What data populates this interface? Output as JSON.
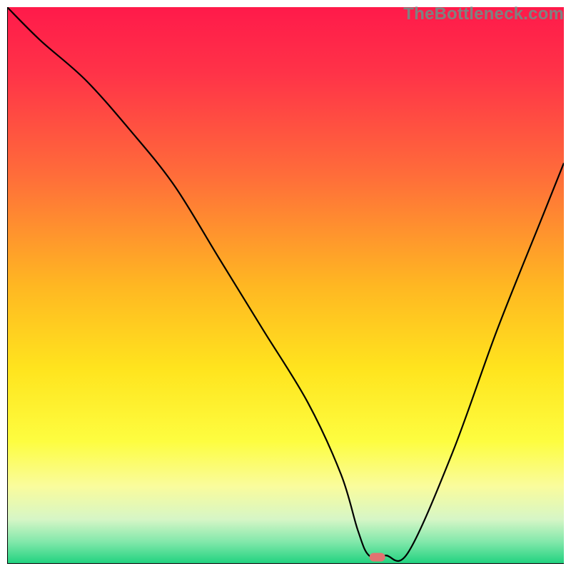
{
  "watermark": "TheBottleneck.com",
  "chart_data": {
    "type": "line",
    "title": "",
    "xlabel": "",
    "ylabel": "",
    "xlim": [
      0,
      100
    ],
    "ylim": [
      0,
      100
    ],
    "grid": false,
    "background_gradient": {
      "type": "vertical",
      "stops": [
        {
          "pos": 0.0,
          "color": "#ff1a4a"
        },
        {
          "pos": 0.12,
          "color": "#ff3348"
        },
        {
          "pos": 0.3,
          "color": "#ff6c3a"
        },
        {
          "pos": 0.5,
          "color": "#ffb722"
        },
        {
          "pos": 0.65,
          "color": "#ffe41e"
        },
        {
          "pos": 0.78,
          "color": "#fdfd40"
        },
        {
          "pos": 0.86,
          "color": "#fafc9c"
        },
        {
          "pos": 0.92,
          "color": "#d6f6c6"
        },
        {
          "pos": 0.96,
          "color": "#83e8ab"
        },
        {
          "pos": 1.0,
          "color": "#1fd27f"
        }
      ]
    },
    "series": [
      {
        "name": "bottleneck-curve",
        "color": "#000000",
        "x": [
          0,
          6,
          14,
          22,
          30,
          38,
          46,
          54,
          60,
          63,
          65,
          68,
          72,
          80,
          88,
          96,
          100
        ],
        "values": [
          100,
          94,
          87,
          78,
          68,
          55,
          42,
          29,
          16,
          6,
          1.5,
          1.5,
          2,
          20,
          42,
          62,
          72
        ]
      }
    ],
    "marker": {
      "name": "optimal-point",
      "x": 66.5,
      "y": 1.2,
      "color": "#e27371",
      "shape": "pill"
    },
    "axes": {
      "left": {
        "visible": true,
        "color": "#000000"
      },
      "bottom": {
        "visible": true,
        "color": "#000000"
      }
    }
  }
}
